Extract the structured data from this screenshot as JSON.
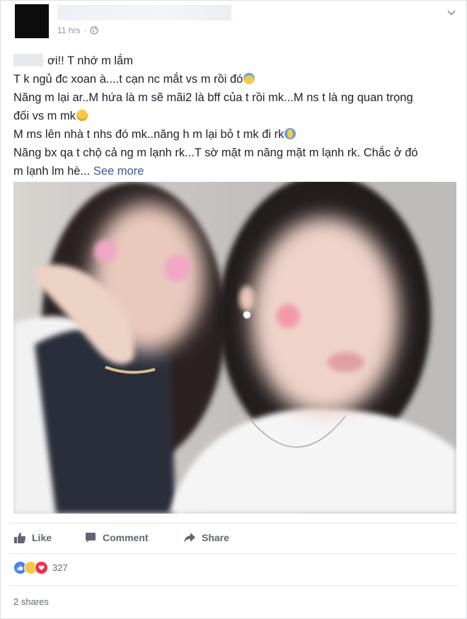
{
  "post": {
    "time": "11 hrs",
    "separator": "·",
    "text_lines": [
      "ơi!! T nhớ m lắm",
      "T k ngủ đc xoan à....t cạn nc mắt vs m rồi đó",
      "Năng m lại ar..M hứa là m sẽ mãi2 là bff của t rồi mk...M ns t là ng quan trọng",
      "đối vs m mk",
      "M ms lên nhà t nhs đó mk..năng h m lại bỏ t mk đi rk",
      "Năng bx qa t chộ cả ng m lạnh rk...T sờ mặt m năng mặt m lạnh rk. Chắc ở đó",
      "m lạnh lm hè..."
    ],
    "see_more": "See more"
  },
  "actions": {
    "like": "Like",
    "comment": "Comment",
    "share": "Share"
  },
  "stats": {
    "reaction_count": "327",
    "shares": "2 shares"
  },
  "icons": [
    "globe-icon",
    "chevron-down-icon",
    "like-icon",
    "comment-icon",
    "share-icon"
  ],
  "colors": {
    "link": "#385898",
    "like_blue": "#4a7ef6",
    "love_red": "#f0304e",
    "muted": "#606770"
  }
}
